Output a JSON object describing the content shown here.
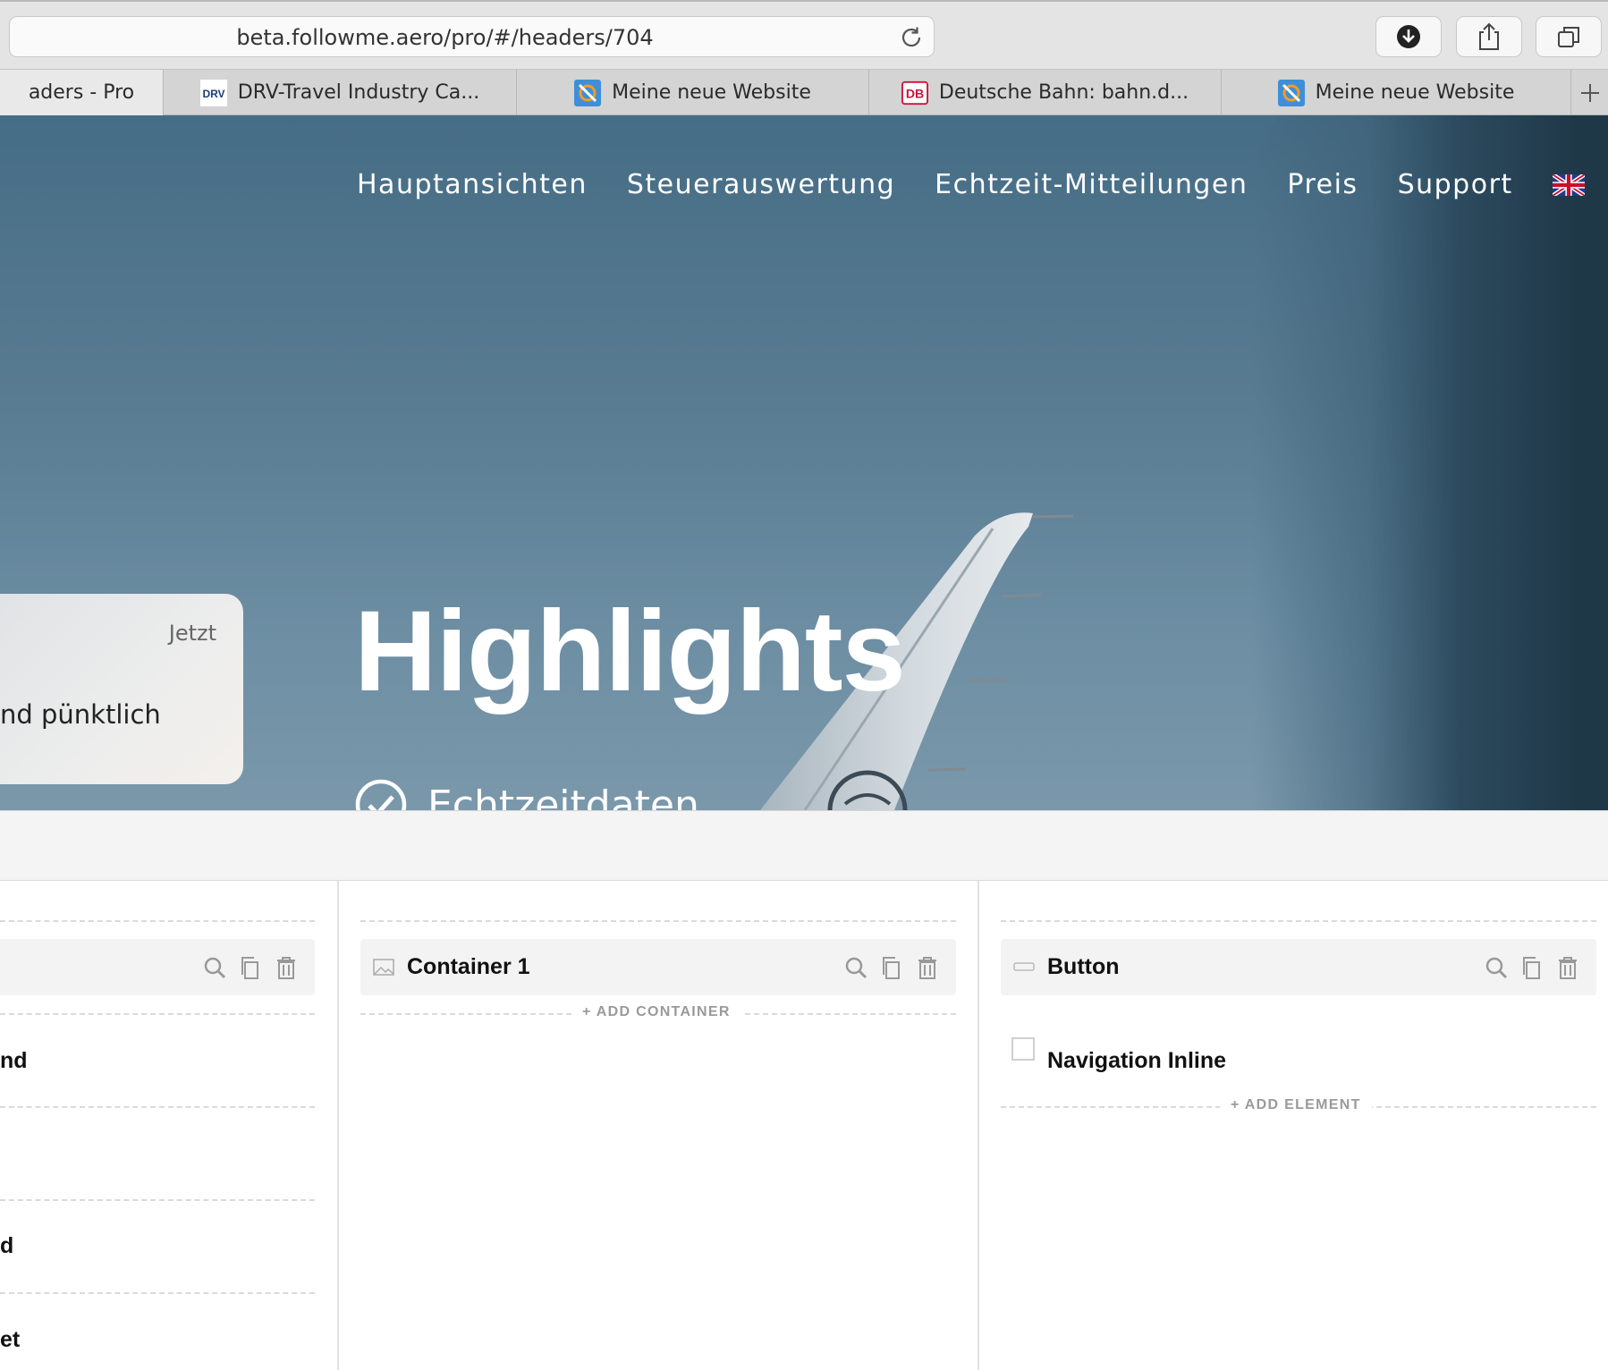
{
  "browser": {
    "url": "beta.followme.aero/pro/#/headers/704",
    "tabs": [
      {
        "label": "aders - Pro",
        "favicon": "none"
      },
      {
        "label": "DRV-Travel Industry Ca...",
        "favicon": "drv-logo"
      },
      {
        "label": "Meine neue Website",
        "favicon": "website-builder-icon"
      },
      {
        "label": "Deutsche Bahn: bahn.d...",
        "favicon": "db-logo"
      },
      {
        "label": "Meine neue Website",
        "favicon": "website-builder-icon"
      }
    ],
    "drv_logo_text": "DRV",
    "db_logo_text": "DB"
  },
  "hero": {
    "nav": [
      "Hauptansichten",
      "Steuerauswertung",
      "Echtzeit-Mitteilungen",
      "Preis",
      "Support"
    ],
    "flag": "uk-flag-icon",
    "notification": {
      "time": "Jetzt",
      "message": "nd pünktlich"
    },
    "title": "Highlights",
    "feature": "Echtzeitdaten"
  },
  "editor": {
    "left_items": [
      "nd",
      "d",
      "et"
    ],
    "middle": {
      "row_label": "Container 1",
      "add_label": "+ ADD CONTAINER"
    },
    "right": {
      "row_label": "Button",
      "item_label": "Navigation Inline",
      "add_label": "+ ADD ELEMENT"
    }
  },
  "colors": {
    "accent_red": "#d0103a",
    "drv_blue": "#1b3c7a",
    "builder_blue": "#3f8fd6",
    "builder_orange": "#f29b2b"
  }
}
